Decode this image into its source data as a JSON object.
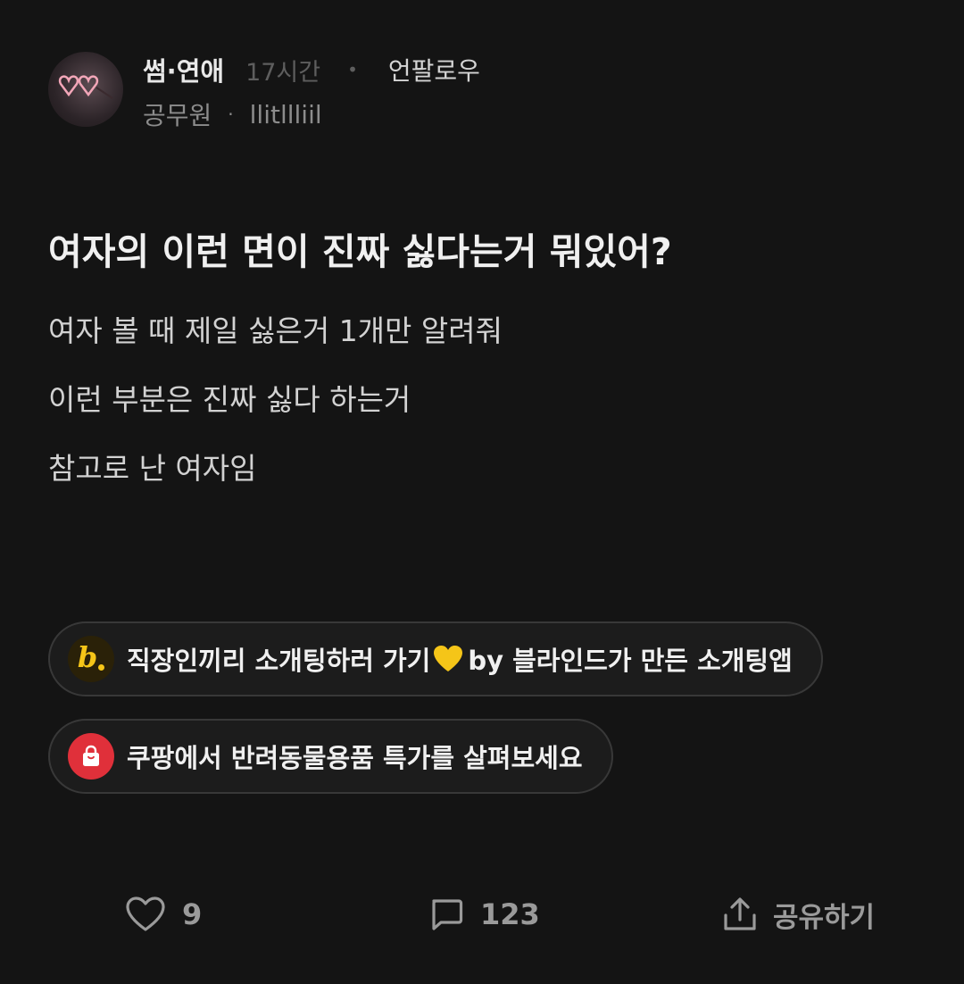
{
  "post": {
    "board": "썸·연애",
    "time": "17시간",
    "follow_label": "언팔로우",
    "author_company": "공무원",
    "author_nickname": "llitllliil",
    "title": "여자의 이런 면이 진짜 싫다는거 뭐있어?",
    "body": [
      "여자 볼 때 제일 싫은거 1개만 알려줘",
      "이런 부분은 진짜 싫다 하는거",
      "참고로 난 여자임"
    ]
  },
  "promos": [
    {
      "icon": "blind-logo-icon",
      "text_before": "직장인끼리 소개팅하러 가기",
      "emoji": "yellow-heart",
      "text_after": "by 블라인드가 만든 소개팅앱"
    },
    {
      "icon": "shopping-bag-icon",
      "text": "쿠팡에서 반려동물용품 특가를 살펴보세요"
    }
  ],
  "actions": {
    "likes": "9",
    "comments": "123",
    "share_label": "공유하기"
  },
  "colors": {
    "background": "#141414",
    "blind_yellow": "#f5c518",
    "coupang_red": "#e0303a"
  }
}
